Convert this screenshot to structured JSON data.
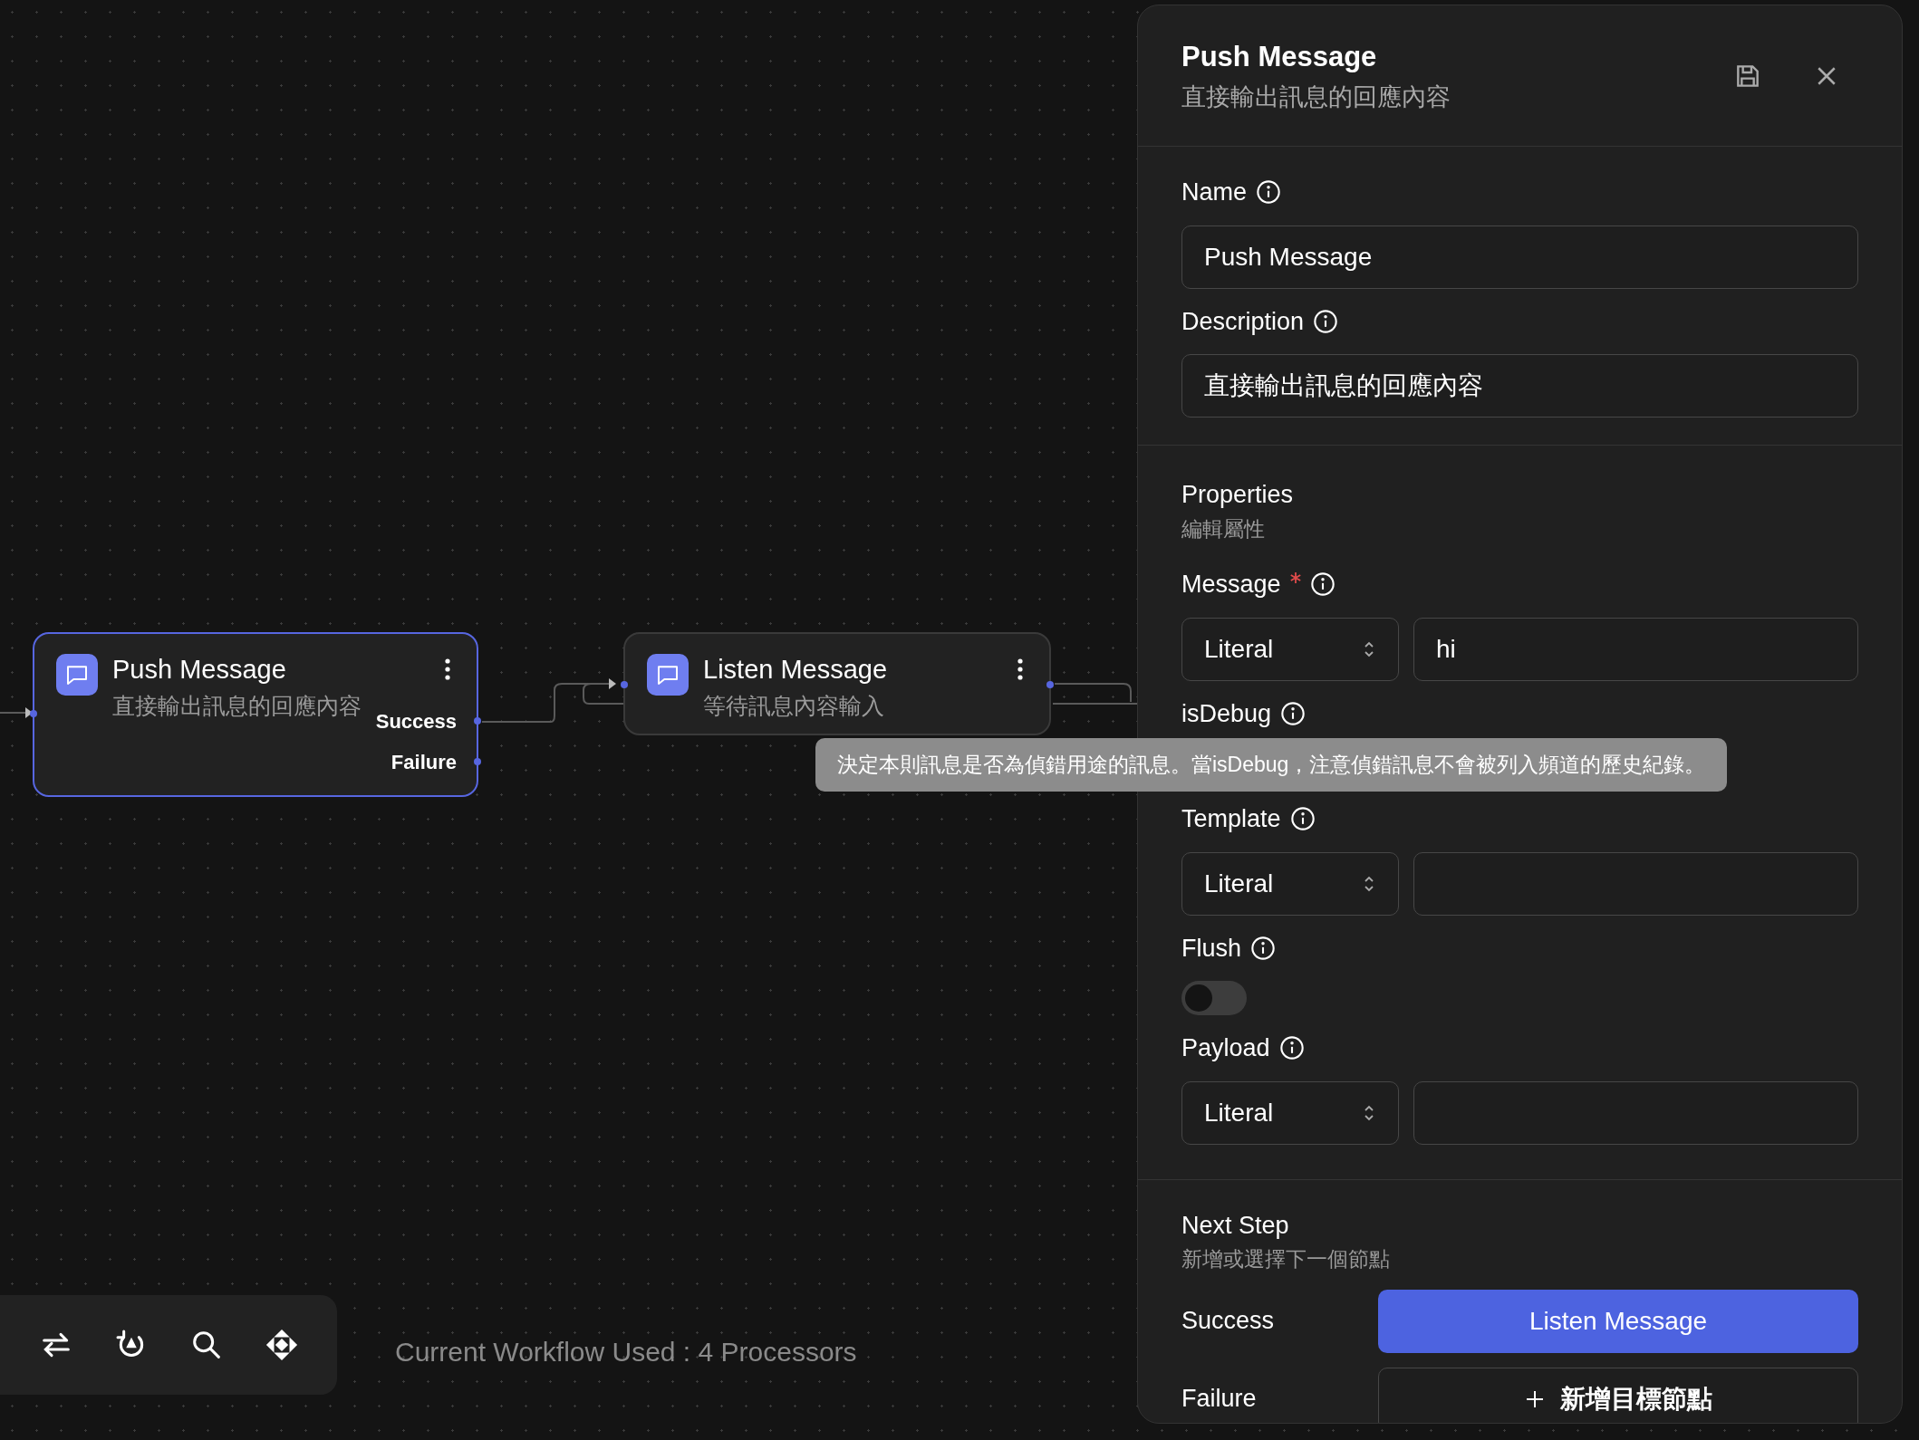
{
  "canvas": {
    "nodes": [
      {
        "title": "Push Message",
        "description": "直接輸出訊息的回應內容",
        "selected": true,
        "outputs": [
          "Success",
          "Failure"
        ]
      },
      {
        "title": "Listen Message",
        "description": "等待訊息內容輸入",
        "selected": false
      }
    ],
    "status_text": "Current Workflow Used : 4 Processors"
  },
  "tooltip": "決定本則訊息是否為偵錯用途的訊息。當isDebug，注意偵錯訊息不會被列入頻道的歷史紀錄。",
  "panel": {
    "title": "Push Message",
    "subtitle": "直接輸出訊息的回應內容",
    "fields": [
      {
        "label": "Name",
        "value": "Push Message"
      },
      {
        "label": "Description",
        "value": "直接輸出訊息的回應內容"
      }
    ],
    "properties": {
      "title": "Properties",
      "subtitle": "編輯屬性",
      "items": [
        {
          "kind": "typed",
          "label": "Message",
          "required": true,
          "type": "Literal",
          "value": "hi"
        },
        {
          "kind": "covered",
          "label": "isDebug",
          "required": false
        },
        {
          "kind": "typed",
          "label": "Template",
          "required": false,
          "type": "Literal"
        },
        {
          "kind": "toggle",
          "label": "Flush",
          "required": false,
          "on": false
        },
        {
          "kind": "typed",
          "label": "Payload",
          "required": false,
          "type": "Literal"
        }
      ]
    },
    "next_step": {
      "title": "Next Step",
      "subtitle": "新增或選擇下一個節點",
      "rows": [
        {
          "kind": "target",
          "label": "Success",
          "button": "Listen Message"
        },
        {
          "kind": "add",
          "label": "Failure",
          "button": "新增目標節點"
        }
      ]
    }
  }
}
